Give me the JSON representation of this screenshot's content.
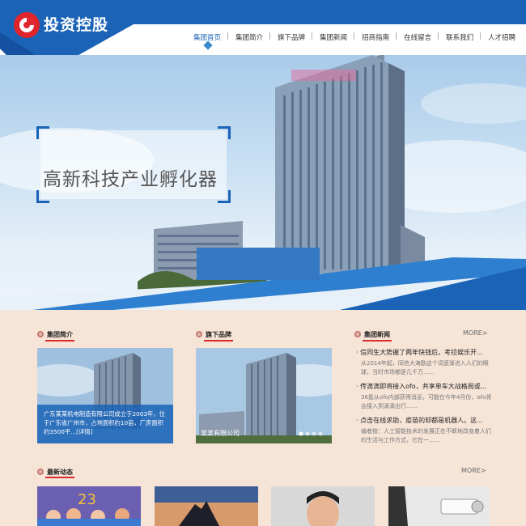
{
  "brand": {
    "name": "投资控股",
    "accent": "#1a63b7",
    "logo_red": "#e0262b"
  },
  "nav": {
    "items": [
      {
        "label": "集团首页",
        "active": true
      },
      {
        "label": "集团简介"
      },
      {
        "label": "旗下品牌"
      },
      {
        "label": "集团新闻"
      },
      {
        "label": "招商指南"
      },
      {
        "label": "在线留言"
      },
      {
        "label": "联系我们"
      },
      {
        "label": "人才招聘"
      }
    ]
  },
  "hero": {
    "title": "高新科技产业孵化器"
  },
  "sections": {
    "about": {
      "title": "集团简介"
    },
    "brands": {
      "title": "旗下品牌"
    },
    "news": {
      "title": "集团新闻",
      "more": "MORE>"
    },
    "latest": {
      "title": "最新动态",
      "more": "MORE>"
    }
  },
  "about": {
    "caption": "广东某某机电制造有限公司成立于2003年，位于广东省广州市，占地面积约10亩，厂房面积约3500平...[详情]"
  },
  "brands": {
    "caption": "某某有限公司"
  },
  "news": [
    {
      "title": "· 信同生大势握了两年快钱后，考拉娱乐开...",
      "desc": "从2014年起，同信大海勤这个词逐渐进入人们的眼球，当时市场都是几千万......"
    },
    {
      "title": "· 传滴滴即将接入ofo，共享单车大战格局或...",
      "desc": "36氪从ofo内部获得消息，可能在今年4月份，ofo将会接入到滴滴出行......"
    },
    {
      "title": "· 点击在线求助，疫苗的却都是机器人。这...",
      "desc": "编者按：人工智能技术的发展正在不断地改变着人们的生活与工作方式，它在一......"
    }
  ]
}
